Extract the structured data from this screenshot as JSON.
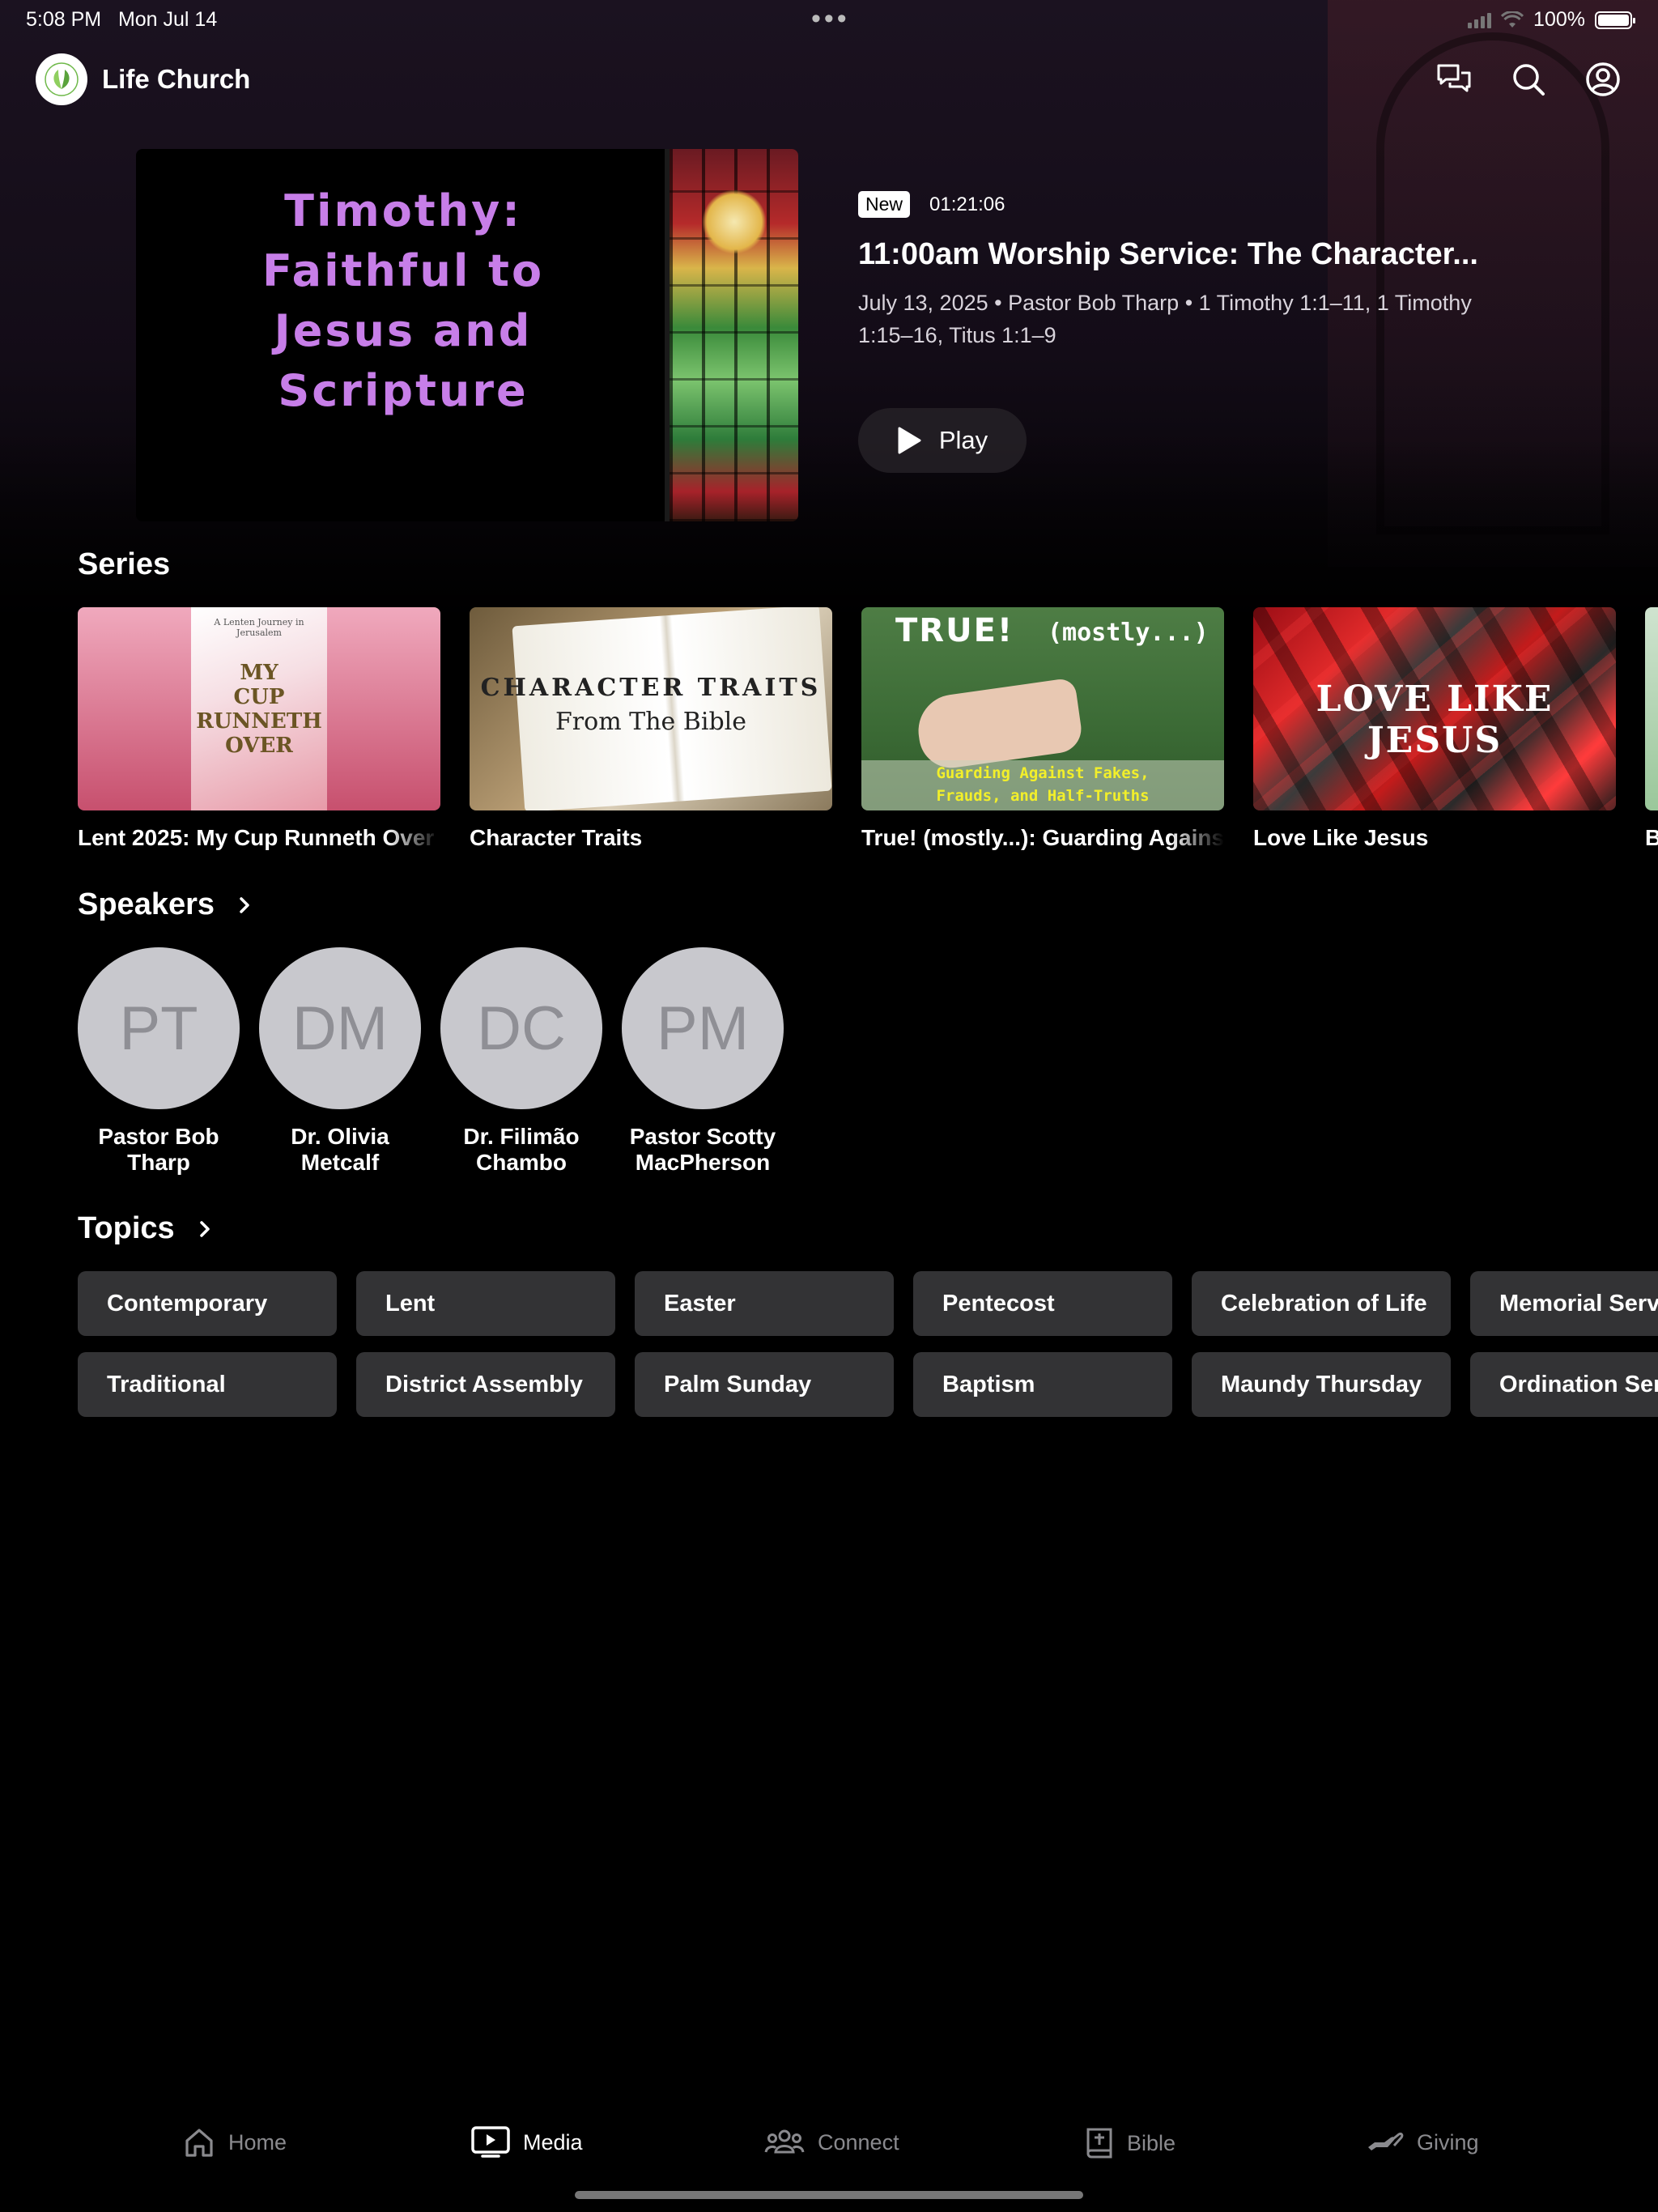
{
  "status_bar": {
    "time": "5:08 PM",
    "date": "Mon Jul 14",
    "battery": "100%"
  },
  "header": {
    "app_name": "Life Church"
  },
  "hero": {
    "badge": "New",
    "duration": "01:21:06",
    "title": "11:00am Worship Service: The Character...",
    "meta": "July 13, 2025 • Pastor Bob Tharp • 1 Timothy 1:1–11, 1 Timothy 1:15–16, Titus 1:1–9",
    "thumb_title": [
      "Timothy:",
      "Faithful to",
      "Jesus and",
      "Scripture"
    ],
    "play_label": "Play"
  },
  "series": {
    "title": "Series",
    "items": [
      {
        "label": "Lent 2025: My Cup Runneth Over",
        "art_lines": [
          "MY",
          "CUP",
          "RUNNETH",
          "OVER"
        ],
        "art_sub": "A Lenten Journey in Jerusalem"
      },
      {
        "label": "Character Traits",
        "art_lines": [
          "CHARACTER TRAITS",
          "From The Bible"
        ]
      },
      {
        "label": "True! (mostly...): Guarding Against Fakes, Frauds, and Half-Truths",
        "art_lines": [
          "TRUE!",
          "(mostly...)",
          "Guarding Against Fakes,",
          "Frauds, and Half-Truths"
        ]
      },
      {
        "label": "Love Like Jesus",
        "art_lines": [
          "LOVE LIKE JESUS"
        ]
      },
      {
        "label": "B"
      }
    ]
  },
  "speakers": {
    "title": "Speakers",
    "items": [
      {
        "initials": "PT",
        "name": "Pastor Bob Tharp"
      },
      {
        "initials": "DM",
        "name": "Dr. Olivia Metcalf"
      },
      {
        "initials": "DC",
        "name": "Dr. Filimão Chambo"
      },
      {
        "initials": "PM",
        "name": "Pastor Scotty MacPherson"
      }
    ]
  },
  "topics": {
    "title": "Topics",
    "row1": [
      "Contemporary",
      "Lent",
      "Easter",
      "Pentecost",
      "Celebration of Life",
      "Memorial Service"
    ],
    "row2": [
      "Traditional",
      "District Assembly",
      "Palm Sunday",
      "Baptism",
      "Maundy Thursday",
      "Ordination Service"
    ]
  },
  "tabbar": {
    "items": [
      {
        "label": "Home",
        "icon": "house-icon",
        "active": false
      },
      {
        "label": "Media",
        "icon": "tv-play-icon",
        "active": true
      },
      {
        "label": "Connect",
        "icon": "people-icon",
        "active": false
      },
      {
        "label": "Bible",
        "icon": "book-plus-icon",
        "active": false
      },
      {
        "label": "Giving",
        "icon": "hand-giving-icon",
        "active": false
      }
    ]
  },
  "colors": {
    "accent_purple": "#c77ee8",
    "chip_bg": "#333335",
    "inactive_tab": "#8a8a8e"
  }
}
